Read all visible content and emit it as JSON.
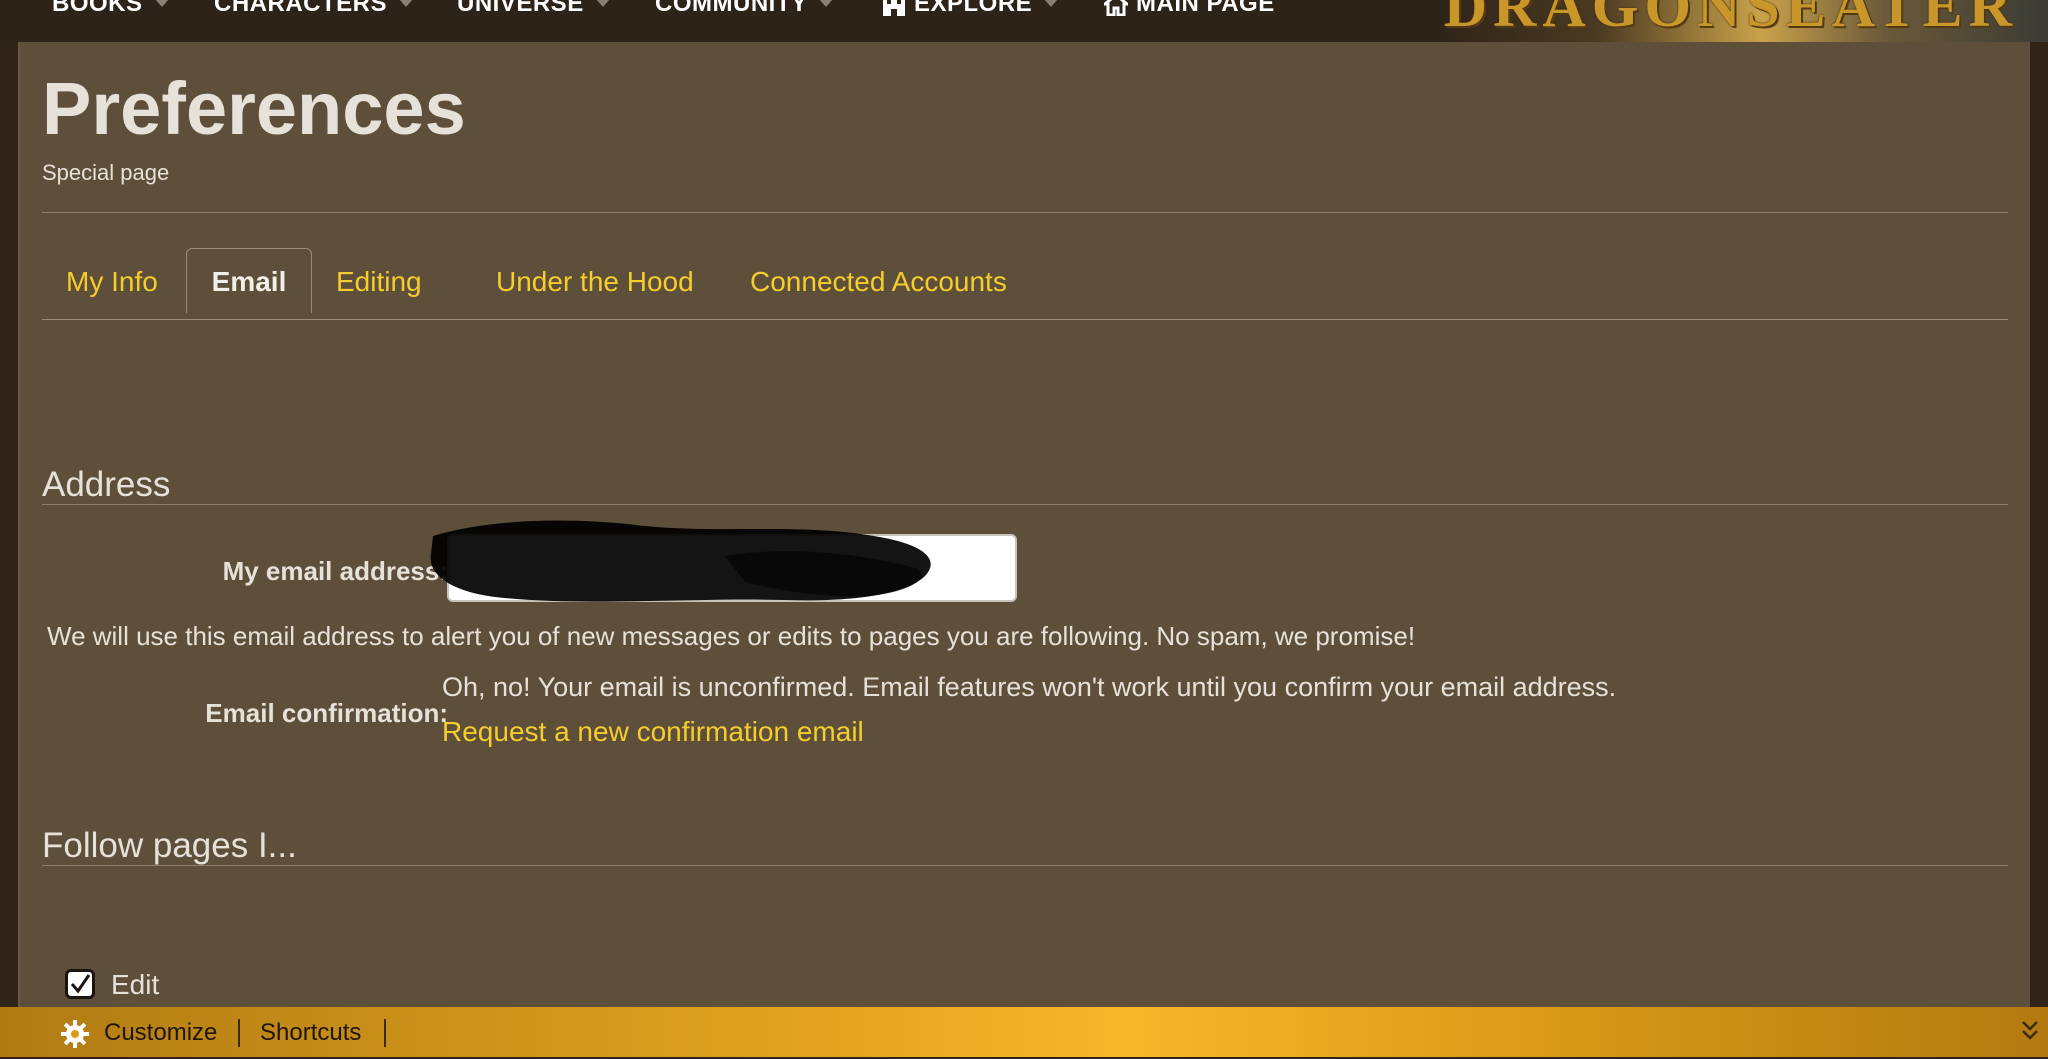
{
  "nav": {
    "items": [
      {
        "label": "BOOKS",
        "has_caret": true
      },
      {
        "label": "CHARACTERS",
        "has_caret": true
      },
      {
        "label": "UNIVERSE",
        "has_caret": true
      },
      {
        "label": "COMMUNITY",
        "has_caret": true
      },
      {
        "label": "EXPLORE",
        "icon": "castle-icon",
        "has_caret": true
      },
      {
        "label": "MAIN PAGE",
        "icon": "home-icon"
      }
    ],
    "brand": "DRAGONSEATER"
  },
  "page": {
    "title": "Preferences",
    "subtitle": "Special page"
  },
  "tabs": [
    {
      "label": "My Info",
      "active": false
    },
    {
      "label": "Email",
      "active": true
    },
    {
      "label": "Editing",
      "active": false
    },
    {
      "label": "Under the Hood",
      "active": false
    },
    {
      "label": "Connected Accounts",
      "active": false
    }
  ],
  "address_section": {
    "heading": "Address",
    "email_label": "My email address:",
    "email_value": "",
    "help_text": "We will use this email address to alert you of new messages or edits to pages you are following. No spam, we promise!",
    "confirmation_label": "Email confirmation:",
    "confirmation_text": "Oh, no! Your email is unconfirmed. Email features won't work until you confirm your email address.",
    "confirmation_link": "Request a new confirmation email"
  },
  "follow_section": {
    "heading": "Follow pages I...",
    "options": [
      {
        "label": "Edit",
        "checked": true
      }
    ]
  },
  "toolbar": {
    "customize_label": "Customize",
    "shortcuts_label": "Shortcuts",
    "icons": {
      "customize": "gear-icon",
      "collapse": "double-chevron-down-icon"
    }
  },
  "colors": {
    "content_bg": "#5e4f3b",
    "link": "#f5cd2c",
    "text": "#e6e1d9",
    "toolbar": "#f6b72b",
    "header": "#2e2318"
  }
}
